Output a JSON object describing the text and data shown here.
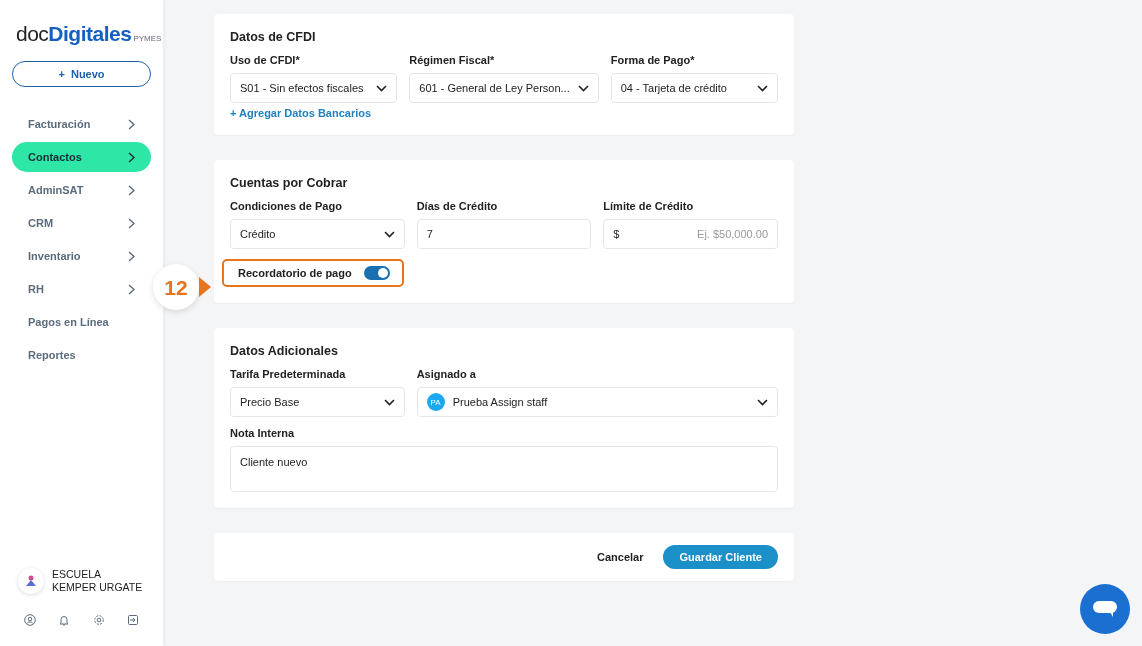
{
  "brand": {
    "prefix": "doc",
    "name": "Digitales",
    "suffix": "PYMES"
  },
  "new_button": {
    "icon": "+",
    "label": "Nuevo"
  },
  "nav": [
    {
      "label": "Facturación",
      "selected": false,
      "has_children": true
    },
    {
      "label": "Contactos",
      "selected": true,
      "has_children": true
    },
    {
      "label": "AdminSAT",
      "selected": false,
      "has_children": true
    },
    {
      "label": "CRM",
      "selected": false,
      "has_children": true
    },
    {
      "label": "Inventario",
      "selected": false,
      "has_children": true
    },
    {
      "label": "RH",
      "selected": false,
      "has_children": true
    },
    {
      "label": "Pagos en Línea",
      "selected": false,
      "has_children": false
    },
    {
      "label": "Reportes",
      "selected": false,
      "has_children": false
    }
  ],
  "account": {
    "name": "ESCUELA KEMPER URGATE"
  },
  "sections": [
    {
      "title": "Datos de CFDI",
      "rows": [
        [
          {
            "kind": "select",
            "label": "Uso de CFDI*",
            "value": "S01 - Sin efectos fiscales"
          },
          {
            "kind": "select",
            "label": "Régimen Fiscal*",
            "value": "601 - General de Ley Person..."
          },
          {
            "kind": "select",
            "label": "Forma de Pago*",
            "value": "04 - Tarjeta de crédito"
          }
        ],
        [
          {
            "kind": "link",
            "label": "+ Agregar Datos Bancarios"
          }
        ]
      ]
    },
    {
      "title": "Cuentas por Cobrar",
      "rows": [
        [
          {
            "kind": "select",
            "label": "Condiciones de Pago",
            "value": "Crédito"
          },
          {
            "kind": "input",
            "label": "Días de Crédito",
            "value": "7"
          },
          {
            "kind": "currency",
            "label": "Límite de Crédito",
            "prefix": "$",
            "placeholder": "Ej. $50,000.00"
          }
        ],
        [
          {
            "kind": "toggle",
            "label": "Recordatorio de pago",
            "on": true,
            "highlighted": true
          }
        ]
      ]
    },
    {
      "title": "Datos Adicionales",
      "rows": [
        [
          {
            "kind": "select",
            "label": "Tarifa Predeterminada",
            "value": "Precio Base"
          },
          {
            "kind": "assignee",
            "label": "Asignado a",
            "initials": "PA",
            "value": "Prueba Assign staff"
          }
        ],
        [
          {
            "kind": "textarea",
            "label": "Nota Interna",
            "value": "Cliente nuevo"
          }
        ]
      ]
    }
  ],
  "actions": {
    "cancel": "Cancelar",
    "save": "Guardar Cliente"
  },
  "callout": {
    "number": "12"
  }
}
